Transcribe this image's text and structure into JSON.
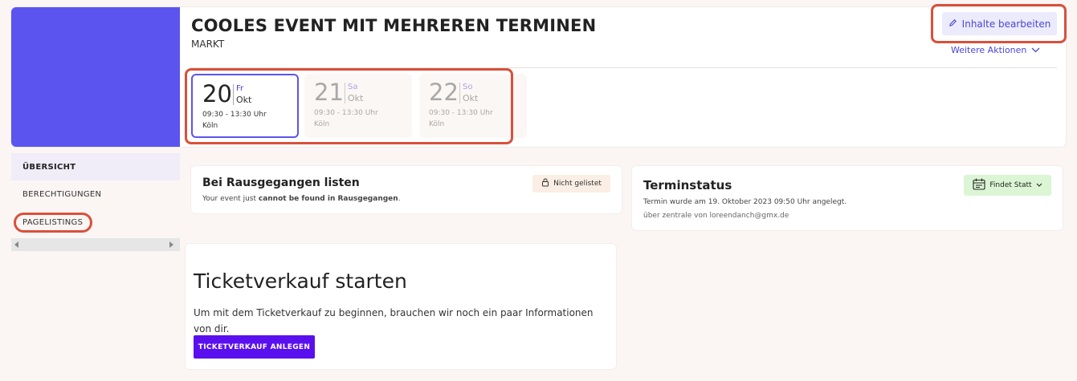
{
  "event": {
    "title": "COOLES EVENT MIT MEHREREN TERMINEN",
    "category": "MARKT"
  },
  "actions": {
    "edit_label": "Inhalte bearbeiten",
    "more_label": "Weitere Aktionen"
  },
  "dates": [
    {
      "day": "20",
      "weekday": "Fr",
      "month": "Okt",
      "time": "09:30 - 13:30 Uhr",
      "city": "Köln",
      "selected": true
    },
    {
      "day": "21",
      "weekday": "Sa",
      "month": "Okt",
      "time": "09:30 - 13:30 Uhr",
      "city": "Köln",
      "selected": false
    },
    {
      "day": "22",
      "weekday": "So",
      "month": "Okt",
      "time": "09:30 - 13:30 Uhr",
      "city": "Köln",
      "selected": false
    }
  ],
  "sidebar": {
    "items": [
      {
        "label": "ÜBERSICHT",
        "active": true
      },
      {
        "label": "BERECHTIGUNGEN",
        "active": false
      },
      {
        "label": "PAGELISTINGS",
        "active": false
      }
    ]
  },
  "listing": {
    "title": "Bei Rausgegangen listen",
    "text_prefix": "Your event just ",
    "text_bold": "cannot be found in Rausgegangen",
    "text_suffix": ".",
    "badge": "Nicht gelistet"
  },
  "status": {
    "title": "Terminstatus",
    "line1": "Termin wurde am 19. Oktober 2023 09:50 Uhr angelegt.",
    "line2": "über zentrale von loreendanch@gmx.de",
    "badge": "Findet Statt"
  },
  "tickets": {
    "title": "Ticketverkauf starten",
    "description": "Um mit dem Ticketverkauf zu beginnen, brauchen wir noch ein paar Informationen von dir.",
    "button": "TICKETVERKAUF ANLEGEN"
  },
  "colors": {
    "accent": "#5b54ee",
    "cta": "#5a10ee",
    "highlight": "#d9503a",
    "status_ok": "#dcf5d4"
  },
  "icons": {
    "edit": "pencil-icon",
    "more": "chevron-down-icon",
    "listing_badge": "lock-icon",
    "status_badge": "calendar-icon"
  }
}
